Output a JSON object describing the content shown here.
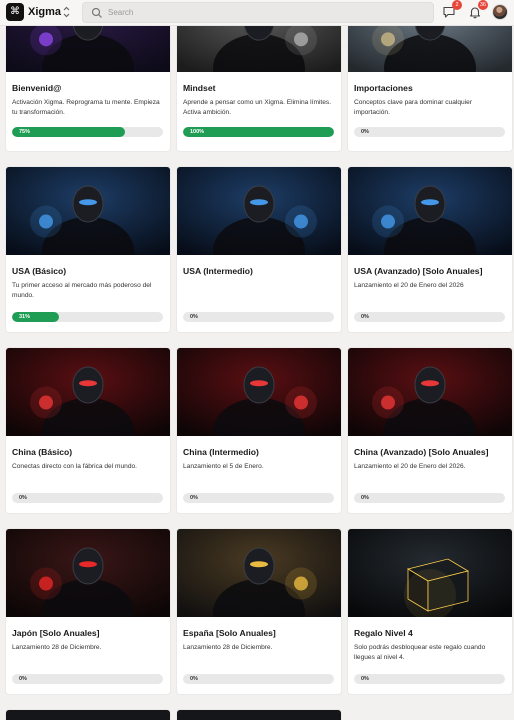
{
  "app": {
    "logo_glyph": "⌘",
    "title": "Xigma"
  },
  "search": {
    "placeholder": "Search",
    "value": ""
  },
  "notifications": {
    "messages_count": "2",
    "alerts_count": "36"
  },
  "courses": [
    {
      "title": "Bienvenid@",
      "description": "Activación Xigma. Reprograma tu mente. Empieza tu transformación.",
      "progress": 75,
      "progress_label": "75%",
      "theme": "purple"
    },
    {
      "title": "Mindset",
      "description": "Aprende a pensar como un Xigma. Elimina límites. Activa ambición.",
      "progress": 100,
      "progress_label": "100%",
      "theme": "gray"
    },
    {
      "title": "Importaciones",
      "description": "Conceptos clave para dominar cualquier importación.",
      "progress": 0,
      "progress_label": "0%",
      "theme": "steel"
    },
    {
      "title": "USA (Básico)",
      "description": "Tu primer acceso al mercado más poderoso del mundo.",
      "progress": 31,
      "progress_label": "31%",
      "theme": "blue"
    },
    {
      "title": "USA (Intermedio)",
      "description": "",
      "progress": 0,
      "progress_label": "0%",
      "theme": "blue"
    },
    {
      "title": "USA (Avanzado) [Solo Anuales]",
      "description": "Lanzamiento el 20 de Enero del 2026",
      "progress": 0,
      "progress_label": "0%",
      "theme": "blue"
    },
    {
      "title": "China (Básico)",
      "description": "Conectas directo con la fábrica del mundo.",
      "progress": 0,
      "progress_label": "0%",
      "theme": "red"
    },
    {
      "title": "China (Intermedio)",
      "description": "Lanzamiento el 5 de Enero.",
      "progress": 0,
      "progress_label": "0%",
      "theme": "red"
    },
    {
      "title": "China (Avanzado) [Solo Anuales]",
      "description": "Lanzamiento el 20 de Enero del 2026.",
      "progress": 0,
      "progress_label": "0%",
      "theme": "red"
    },
    {
      "title": "Japón [Solo Anuales]",
      "description": "Lanzamiento 28 de Diciembre.",
      "progress": 0,
      "progress_label": "0%",
      "theme": "crimson"
    },
    {
      "title": "España [Solo Anuales]",
      "description": "Lanzamiento 28 de Diciembre.",
      "progress": 0,
      "progress_label": "0%",
      "theme": "gold"
    },
    {
      "title": "Regalo Nivel 4",
      "description": "Solo podrás desbloquear este regalo cuando llegues al nivel 4.",
      "progress": 0,
      "progress_label": "0%",
      "theme": "box"
    }
  ],
  "colors": {
    "progress_fill": "#1f9d55",
    "progress_track": "#e8e8e8",
    "badge": "#e8463b"
  }
}
